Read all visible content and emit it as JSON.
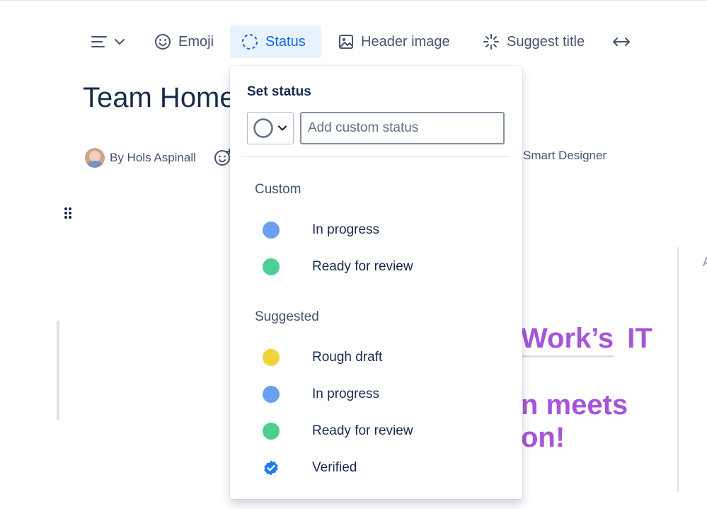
{
  "toolbar": {
    "emoji_label": "Emoji",
    "status_label": "Status",
    "header_image_label": "Header image",
    "suggest_title_label": "Suggest title"
  },
  "page": {
    "title": "Team Home",
    "byline": "By Hols Aspinall",
    "byline_right": "Smart Designer",
    "edge_char": "A",
    "content_line1": "Work’s",
    "content_line1_b": "IT",
    "content_line2": "n meets",
    "content_line3": "on!"
  },
  "status_popup": {
    "title": "Set status",
    "input_placeholder": "Add custom status",
    "custom_section": "Custom",
    "custom": [
      {
        "label": "In progress",
        "color": "#6b9ff0"
      },
      {
        "label": "Ready for review",
        "color": "#4bcf94"
      }
    ],
    "suggested_section": "Suggested",
    "suggested": [
      {
        "label": "Rough draft",
        "color": "#f0d23a"
      },
      {
        "label": "In progress",
        "color": "#6b9ff0"
      },
      {
        "label": "Ready for review",
        "color": "#4bcf94"
      },
      {
        "label": "Verified",
        "color": "#1d7afc",
        "icon": "verified-badge-icon"
      }
    ]
  },
  "colors": {
    "accent": "#0c66e4",
    "accent_bg": "#e9f2ff",
    "purple_text": "#a655d8"
  }
}
